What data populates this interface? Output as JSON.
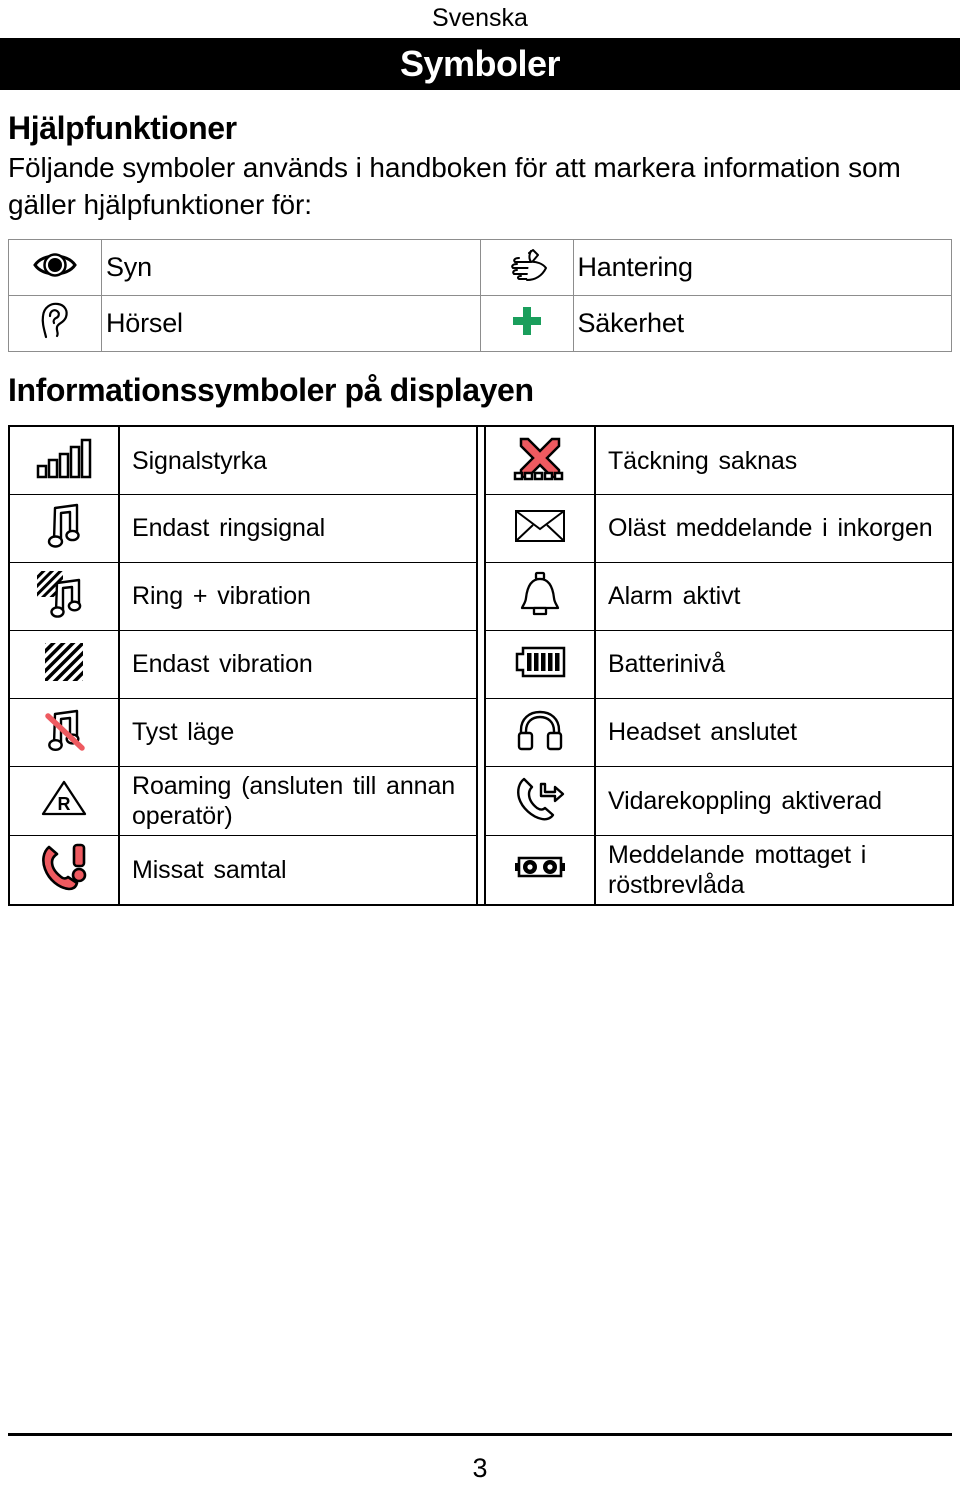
{
  "running_head": "Svenska",
  "chapter": {
    "title": "Symboler"
  },
  "section": {
    "heading": "Hjälpfunktioner",
    "intro": "Följande symboler används i handboken för att markera information som gäller hjälpfunktioner för:"
  },
  "helper_table": {
    "rows": [
      {
        "left": {
          "icon": "eye-icon",
          "label": "Syn"
        },
        "right": {
          "icon": "hand-icon",
          "label": "Hantering"
        }
      },
      {
        "left": {
          "icon": "ear-icon",
          "label": "Hörsel"
        },
        "right": {
          "icon": "green-cross-icon",
          "label": "Säkerhet"
        }
      }
    ]
  },
  "display_section": {
    "heading": "Informationssymboler på displayen"
  },
  "display_table": {
    "rows": [
      {
        "left": {
          "icon": "signal-strength-icon",
          "label": "Signalstyrka"
        },
        "right": {
          "icon": "no-coverage-icon",
          "label": "Täckning saknas"
        }
      },
      {
        "left": {
          "icon": "ring-only-icon",
          "label": "Endast ringsignal"
        },
        "right": {
          "icon": "unread-message-icon",
          "label": "Oläst meddelande i inkorgen"
        }
      },
      {
        "left": {
          "icon": "ring-and-vibrate-icon",
          "label": "Ring + vibration"
        },
        "right": {
          "icon": "alarm-bell-icon",
          "label": "Alarm aktivt"
        }
      },
      {
        "left": {
          "icon": "vibrate-only-icon",
          "label": "Endast vibration"
        },
        "right": {
          "icon": "battery-level-icon",
          "label": "Batterinivå"
        }
      },
      {
        "left": {
          "icon": "silent-mode-icon",
          "label": "Tyst läge"
        },
        "right": {
          "icon": "headset-icon",
          "label": "Headset anslutet"
        }
      },
      {
        "left": {
          "icon": "roaming-icon",
          "label": "Roaming (ansluten till annan operatör)"
        },
        "right": {
          "icon": "call-forward-icon",
          "label": "Vidarekoppling aktiverad"
        }
      },
      {
        "left": {
          "icon": "missed-call-icon",
          "label": "Missat samtal"
        },
        "right": {
          "icon": "voicemail-icon",
          "label": "Meddelande mottaget i röstbrevlåda"
        }
      }
    ]
  },
  "footer": {
    "page_number": "3"
  },
  "colors": {
    "banner_background": "#000000",
    "banner_text": "#ffffff",
    "safety_green": "#1a9e5c",
    "alert_red": "#ee5a60",
    "helper_table_border": "#8d8d8d",
    "display_table_border": "#000000"
  }
}
